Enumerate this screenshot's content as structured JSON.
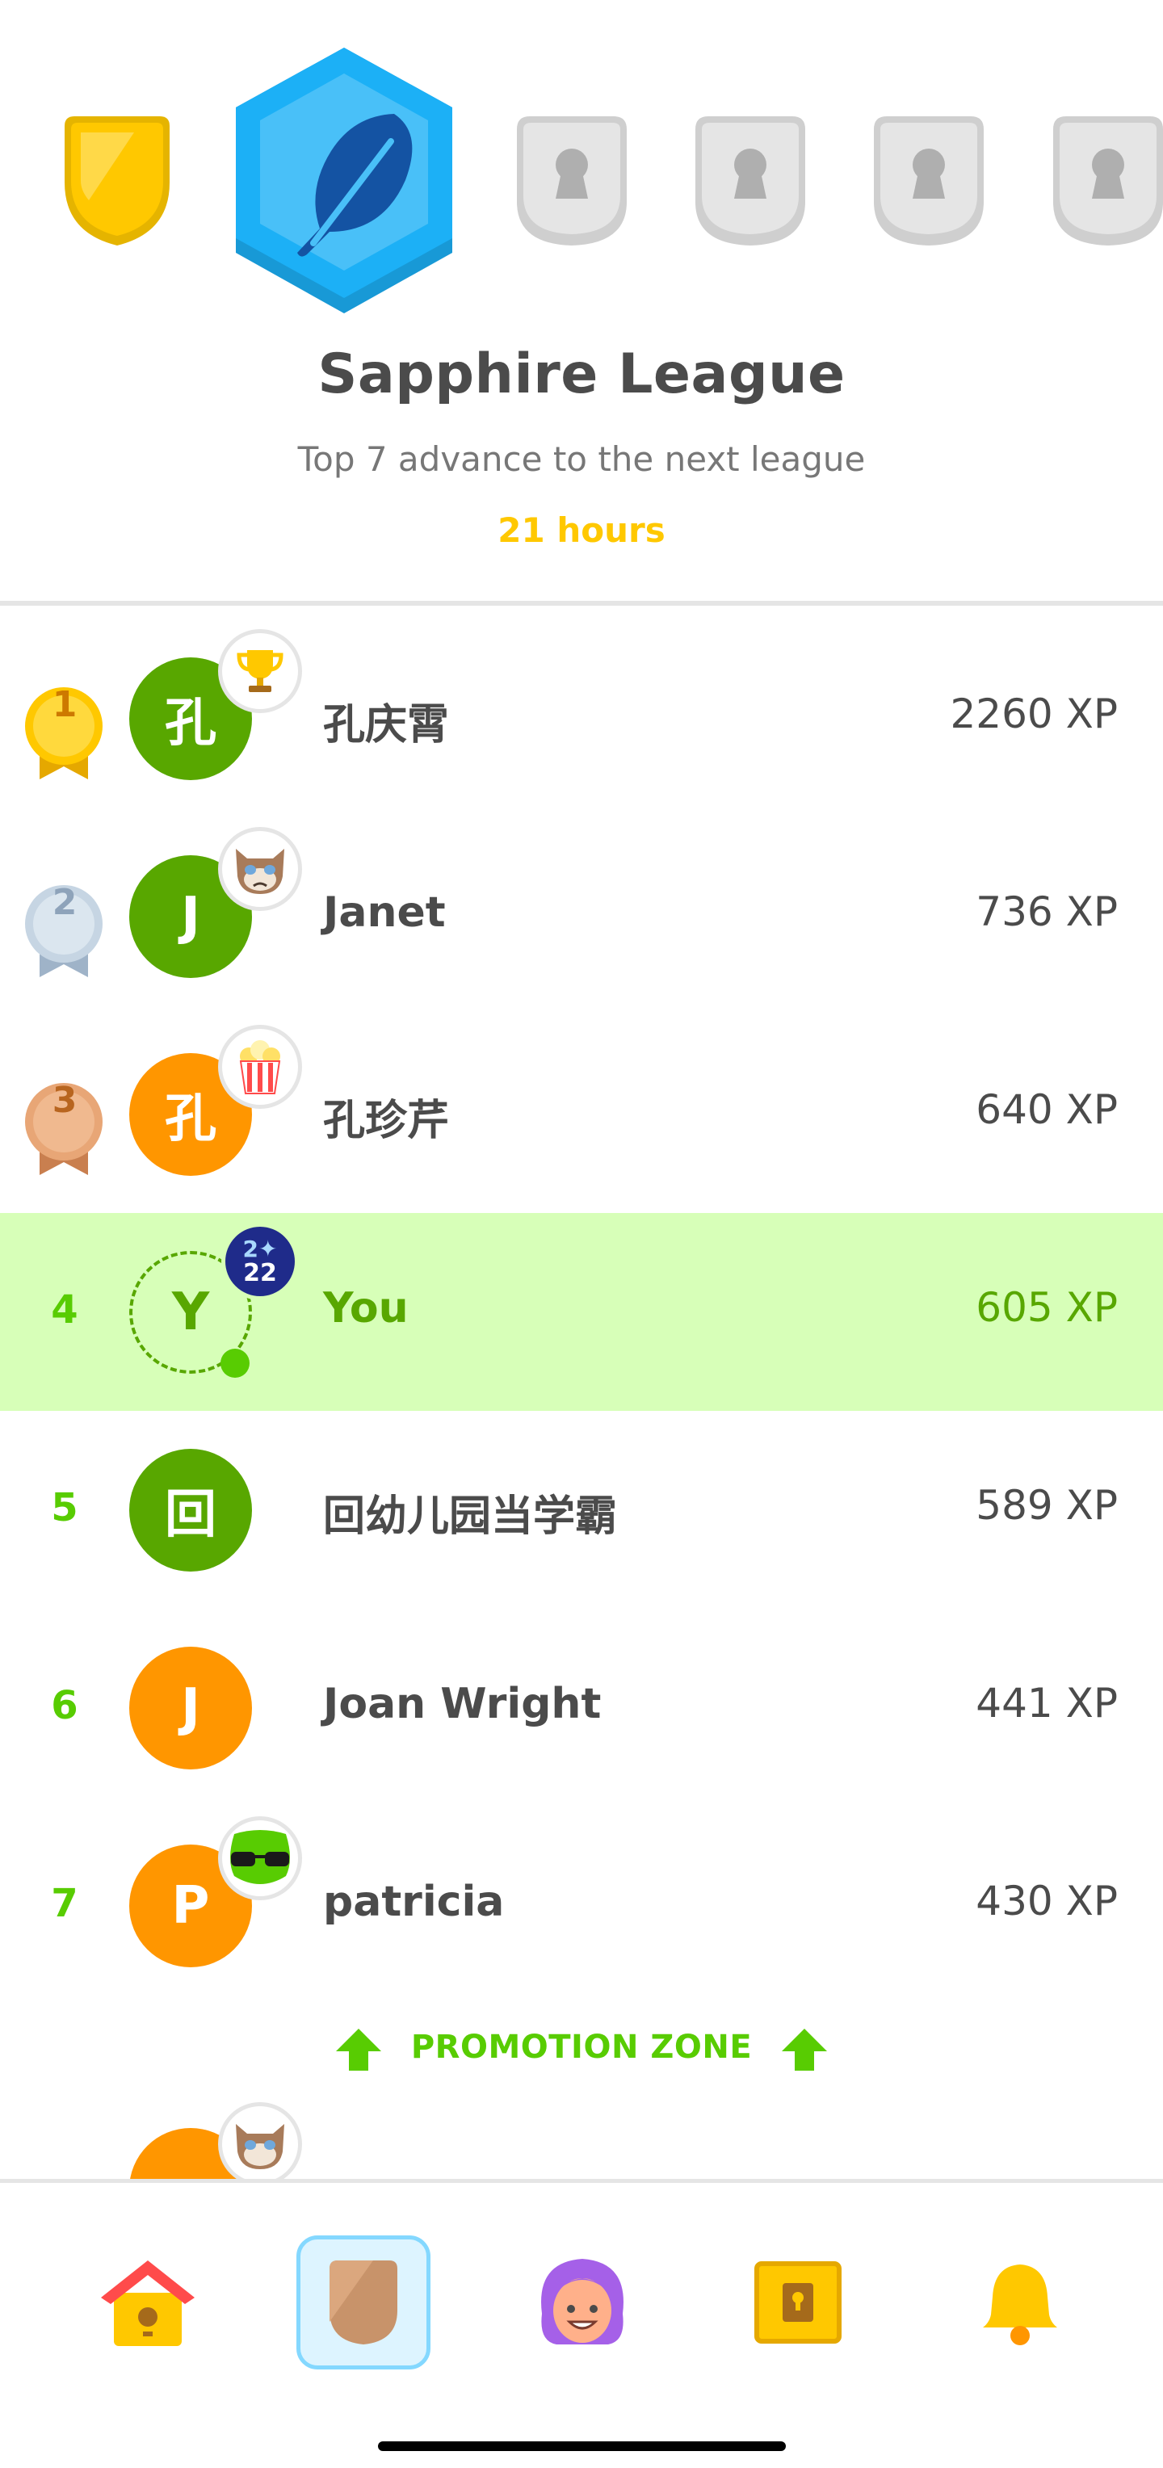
{
  "league": {
    "title": "Sapphire League",
    "subtitle": "Top 7 advance to the next league",
    "time_left": "21 hours",
    "badges": [
      {
        "name": "gold",
        "state": "completed"
      },
      {
        "name": "sapphire",
        "state": "current"
      },
      {
        "name": "locked",
        "state": "locked"
      },
      {
        "name": "locked",
        "state": "locked"
      },
      {
        "name": "locked",
        "state": "locked"
      },
      {
        "name": "locked",
        "state": "locked"
      }
    ]
  },
  "leaderboard": [
    {
      "rank": "1",
      "initial": "孔",
      "name": "孔庆霄",
      "xp": "2260 XP",
      "avatar_color": "#58a700",
      "badge_icon": "trophy-icon"
    },
    {
      "rank": "2",
      "initial": "J",
      "name": "Janet",
      "xp": "736 XP",
      "avatar_color": "#58a700",
      "badge_icon": "grumpy-cat-icon"
    },
    {
      "rank": "3",
      "initial": "孔",
      "name": "孔珍芹",
      "xp": "640 XP",
      "avatar_color": "#ff9600",
      "badge_icon": "popcorn-icon"
    },
    {
      "rank": "4",
      "initial": "Y",
      "name": "You",
      "xp": "605 XP",
      "avatar_color": "#58a700",
      "badge_text_top": "2✦",
      "badge_text_bottom": "22",
      "is_you": true
    },
    {
      "rank": "5",
      "initial": "回",
      "name": "回幼儿园当学霸",
      "xp": "589 XP",
      "avatar_color": "#58a700"
    },
    {
      "rank": "6",
      "initial": "J",
      "name": "Joan Wright",
      "xp": "441 XP",
      "avatar_color": "#ff9600"
    },
    {
      "rank": "7",
      "initial": "P",
      "name": "patricia",
      "xp": "430 XP",
      "avatar_color": "#ff9600",
      "badge_icon": "sunglasses-owl-icon"
    }
  ],
  "promotion_zone": {
    "label": "PROMOTION ZONE"
  },
  "nav": {
    "items": [
      {
        "name": "home",
        "icon": "birdhouse-icon"
      },
      {
        "name": "leagues",
        "icon": "shield-icon",
        "active": true
      },
      {
        "name": "profile",
        "icon": "avatar-icon"
      },
      {
        "name": "shop",
        "icon": "treasure-chest-icon"
      },
      {
        "name": "alerts",
        "icon": "bell-icon"
      }
    ]
  },
  "colors": {
    "green": "#58cc02",
    "dark_green": "#58a700",
    "orange": "#ff9600",
    "you_highlight": "#d7ffb8",
    "gold": "#ffc800",
    "sapphire": "#1cb0f6"
  }
}
